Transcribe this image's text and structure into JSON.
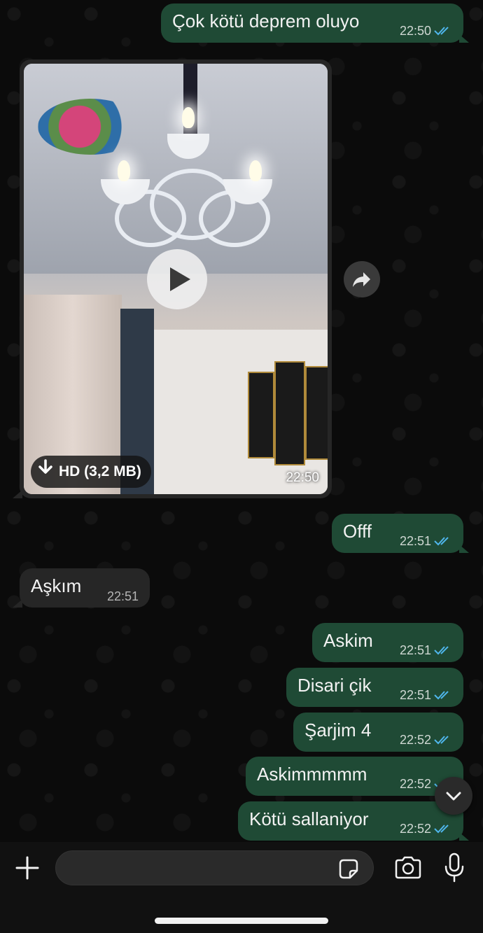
{
  "messages": [
    {
      "id": "m1",
      "direction": "out",
      "text": "Çok kötü deprem oluyo",
      "time": "22:50"
    },
    {
      "id": "m3",
      "direction": "out",
      "text": "Offf",
      "time": "22:51"
    },
    {
      "id": "m4",
      "direction": "in",
      "text": "Aşkım",
      "time": "22:51"
    },
    {
      "id": "m5",
      "direction": "out",
      "text": "Askim",
      "time": "22:51"
    },
    {
      "id": "m6",
      "direction": "out",
      "text": "Disari çik",
      "time": "22:51"
    },
    {
      "id": "m7",
      "direction": "out",
      "text": "Şarjim 4",
      "time": "22:52"
    },
    {
      "id": "m8",
      "direction": "out",
      "text": "Askimmmmm",
      "time": "22:52"
    },
    {
      "id": "m9",
      "direction": "out",
      "text": "Kötü sallaniyor",
      "time": "22:52"
    }
  ],
  "video_message": {
    "download_label": "HD (3,2 MB)",
    "time": "22:50",
    "play_icon": "play-icon",
    "download_icon": "download-icon"
  },
  "icons": {
    "forward": "forward-icon",
    "scroll_down": "chevron-down-icon",
    "attach": "plus-icon",
    "sticker": "sticker-icon",
    "camera": "camera-icon",
    "mic": "microphone-icon",
    "read_receipt": "double-check-icon"
  },
  "composer": {
    "placeholder": ""
  },
  "colors": {
    "outgoing_bubble": "#1f4a35",
    "incoming_bubble": "#262626",
    "read_tick": "#4fb6ec",
    "background": "#0b0b0b"
  }
}
